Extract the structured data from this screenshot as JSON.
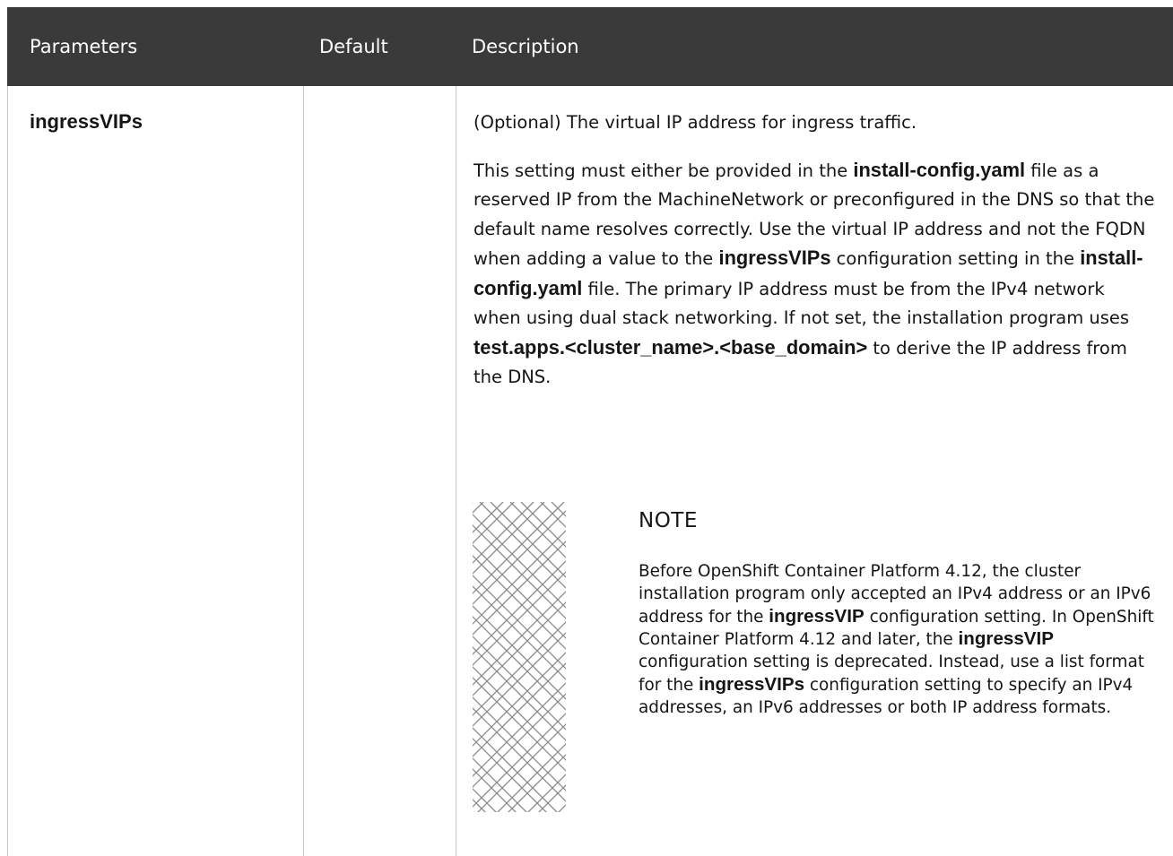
{
  "table": {
    "headers": [
      "Parameters",
      "Default",
      "Description"
    ],
    "row": {
      "parameter": "ingressVIPs",
      "default": "",
      "description": {
        "p1": "(Optional) The virtual IP address for ingress traffic.",
        "p2": [
          {
            "t": "This setting must either be provided in the ",
            "b": false
          },
          {
            "t": "install-config.yaml",
            "b": true
          },
          {
            "t": " file as a reserved IP from the MachineNetwork or preconfigured in the DNS so that the default name resolves correctly. Use the virtual IP address and not the FQDN when adding a value to the ",
            "b": false
          },
          {
            "t": "ingressVIPs",
            "b": true
          },
          {
            "t": " configuration setting in the ",
            "b": false
          },
          {
            "t": "install-config.yaml",
            "b": true
          },
          {
            "t": " file. The primary IP address must be from the IPv4 network when using dual stack networking. If not set, the installation program uses ",
            "b": false
          },
          {
            "t": "test.apps.<cluster_name>.<base_domain>",
            "b": true
          },
          {
            "t": " to derive the IP address from the DNS.",
            "b": false
          }
        ]
      },
      "note": {
        "title": "NOTE",
        "body": [
          {
            "t": "Before OpenShift Container Platform 4.12, the cluster installation program only accepted an IPv4 address or an IPv6 address for the ",
            "b": false
          },
          {
            "t": "ingressVIP",
            "b": true
          },
          {
            "t": " configuration setting. In OpenShift Container Platform 4.12 and later, the ",
            "b": false
          },
          {
            "t": "ingressVIP",
            "b": true
          },
          {
            "t": " configuration setting is deprecated. Instead, use a list format for the ",
            "b": false
          },
          {
            "t": "ingressVIPs",
            "b": true
          },
          {
            "t": " configuration setting to specify an IPv4 addresses, an IPv6 addresses or both IP address formats.",
            "b": false
          }
        ]
      }
    }
  },
  "icons": {
    "note_pattern": "lattice-pattern-icon"
  },
  "colors": {
    "header_bg": "#3a3a3a",
    "header_text": "#ffffff",
    "divider": "#c8c8c8",
    "text": "#151515"
  }
}
